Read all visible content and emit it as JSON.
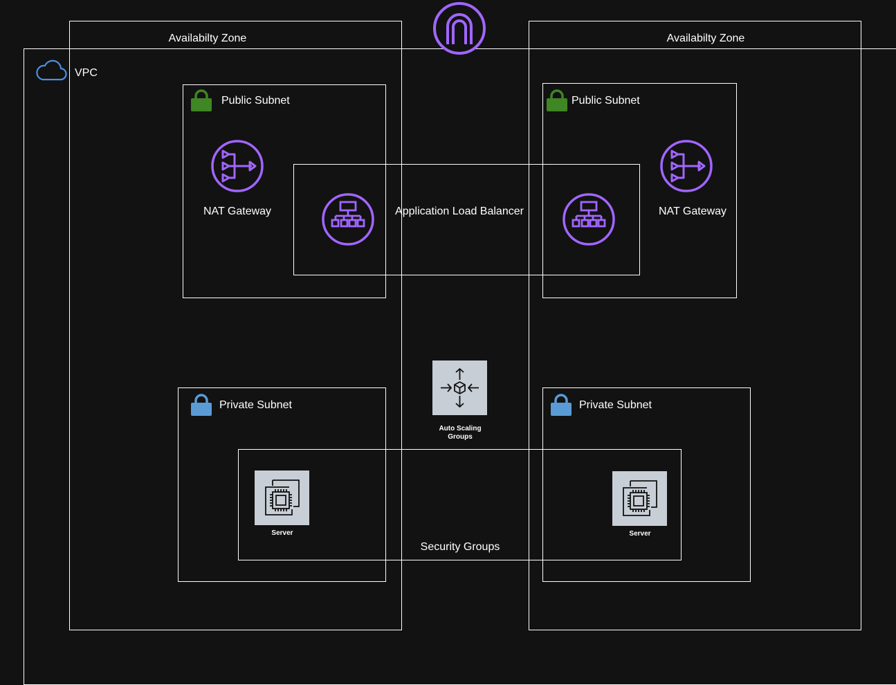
{
  "diagram": {
    "vpc": {
      "label": "VPC"
    },
    "availability_zones": [
      {
        "label": "Availabilty Zone"
      },
      {
        "label": "Availabilty Zone"
      }
    ],
    "public_subnets": [
      {
        "label": "Public Subnet"
      },
      {
        "label": "Public Subnet"
      }
    ],
    "private_subnets": [
      {
        "label": "Private Subnet"
      },
      {
        "label": "Private Subnet"
      }
    ],
    "nat_gateways": [
      {
        "label": "NAT Gateway"
      },
      {
        "label": "NAT Gateway"
      }
    ],
    "load_balancer": {
      "label": "Application Load Balancer"
    },
    "auto_scaling": {
      "label_line1": "Auto Scaling",
      "label_line2": "Groups"
    },
    "security_groups": {
      "label": "Security Groups"
    },
    "servers": [
      {
        "label": "Server"
      },
      {
        "label": "Server"
      }
    ]
  },
  "colors": {
    "background": "#121212",
    "border": "#ffffff",
    "aws_purple": "#a166ff",
    "vpc_blue": "#4a90e2",
    "public_green": "#3f8624",
    "private_blue": "#5a9bd5",
    "tile_gray": "#c7ced6"
  },
  "icons": {
    "internet_gateway": "internet-gateway-icon",
    "vpc": "cloud-icon",
    "public_subnet": "green-lock-icon",
    "private_subnet": "blue-lock-icon",
    "nat_gateway": "nat-gateway-icon",
    "load_balancer": "load-balancer-icon",
    "auto_scaling": "auto-scaling-icon",
    "server": "ec2-instance-icon"
  }
}
